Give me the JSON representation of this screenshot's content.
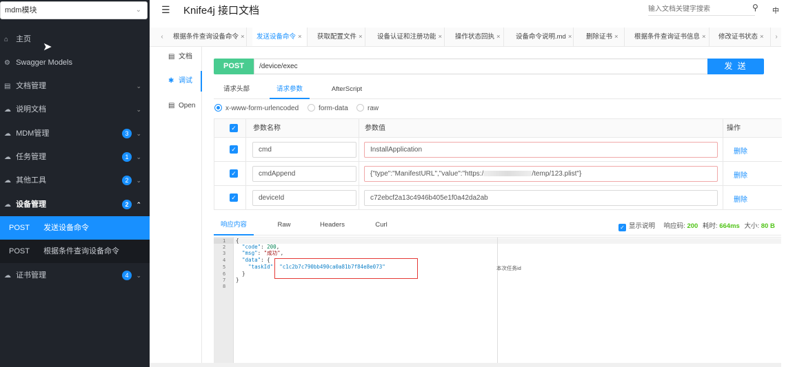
{
  "sidebar": {
    "module_select": "mdm模块",
    "items": [
      {
        "label": "主页"
      },
      {
        "label": "Swagger Models"
      },
      {
        "label": "文档管理"
      },
      {
        "label": "说明文档"
      },
      {
        "label": "MDM管理",
        "badge": "3"
      },
      {
        "label": "任务管理",
        "badge": "1"
      },
      {
        "label": "其他工具",
        "badge": "2"
      },
      {
        "label": "设备管理",
        "badge": "2"
      },
      {
        "label": "证书管理",
        "badge": "4"
      }
    ],
    "sub_items": [
      {
        "method": "POST",
        "label": "发送设备命令"
      },
      {
        "method": "POST",
        "label": "根据条件查询设备命令"
      }
    ]
  },
  "header": {
    "title": "Knife4j 接口文档",
    "search_placeholder": "输入文档关键字搜索",
    "lang": "中"
  },
  "tabs": [
    {
      "label": "根据条件查询设备命令"
    },
    {
      "label": "发送设备命令"
    },
    {
      "label": "获取配置文件"
    },
    {
      "label": "设备认证和注册功能"
    },
    {
      "label": "操作状态回执"
    },
    {
      "label": "设备命令说明.md"
    },
    {
      "label": "删除证书"
    },
    {
      "label": "根据条件查询证书信息"
    },
    {
      "label": "修改证书状态"
    }
  ],
  "subnav": {
    "doc": "文档",
    "debug": "调试",
    "open": "Open"
  },
  "request": {
    "method": "POST",
    "url": "/device/exec",
    "send_label": "发 送",
    "tabs": {
      "headers": "请求头部",
      "params": "请求参数",
      "after": "AfterScript"
    },
    "content_types": {
      "urlencoded": "x-www-form-urlencoded",
      "formdata": "form-data",
      "raw": "raw"
    },
    "table": {
      "col_name": "参数名称",
      "col_value": "参数值",
      "col_action": "操作",
      "rows": [
        {
          "name": "cmd",
          "value": "InstallApplication",
          "action": "删除"
        },
        {
          "name": "cmdAppend",
          "value_prefix": "{\"type\":\"ManifestURL\",\"value\":\"https:/",
          "value_suffix": "/temp/123.plist\"}",
          "action": "删除"
        },
        {
          "name": "deviceId",
          "value": "c72ebcf2a13c4946b405e1f0a42da2ab",
          "action": "删除"
        }
      ]
    }
  },
  "response": {
    "tabs": {
      "content": "响应内容",
      "raw": "Raw",
      "headers": "Headers",
      "curl": "Curl"
    },
    "show_desc": "显示说明",
    "code_label": "响应码:",
    "code": "200",
    "time_label": "耗时:",
    "time": "664ms",
    "size_label": "大小:",
    "size": "80 B",
    "lines": [
      "1",
      "2",
      "3",
      "4",
      "5",
      "6",
      "7",
      "8"
    ],
    "json": {
      "code": "200",
      "msg": "\"成功\"",
      "task_id": "\"c1c2b7c790bb490ca0a81b7f84e8e073\""
    },
    "task_desc": "本次任务id"
  }
}
